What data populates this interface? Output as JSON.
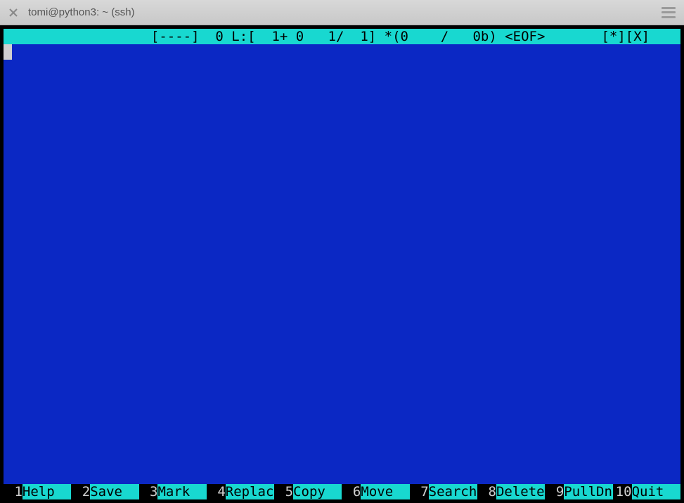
{
  "window": {
    "title": "tomi@python3: ~ (ssh)"
  },
  "status": {
    "text": "                  [----]  0 L:[  1+ 0   1/  1] *(0    /   0b) <EOF>       [*][X]"
  },
  "fkeys": [
    {
      "num": " 1",
      "label": "Help  "
    },
    {
      "num": " 2",
      "label": "Save  "
    },
    {
      "num": " 3",
      "label": "Mark  "
    },
    {
      "num": " 4",
      "label": "Replac"
    },
    {
      "num": " 5",
      "label": "Copy  "
    },
    {
      "num": " 6",
      "label": "Move  "
    },
    {
      "num": " 7",
      "label": "Search"
    },
    {
      "num": " 8",
      "label": "Delete"
    },
    {
      "num": " 9",
      "label": "PullDn"
    },
    {
      "num": "10",
      "label": "Quit  "
    }
  ]
}
